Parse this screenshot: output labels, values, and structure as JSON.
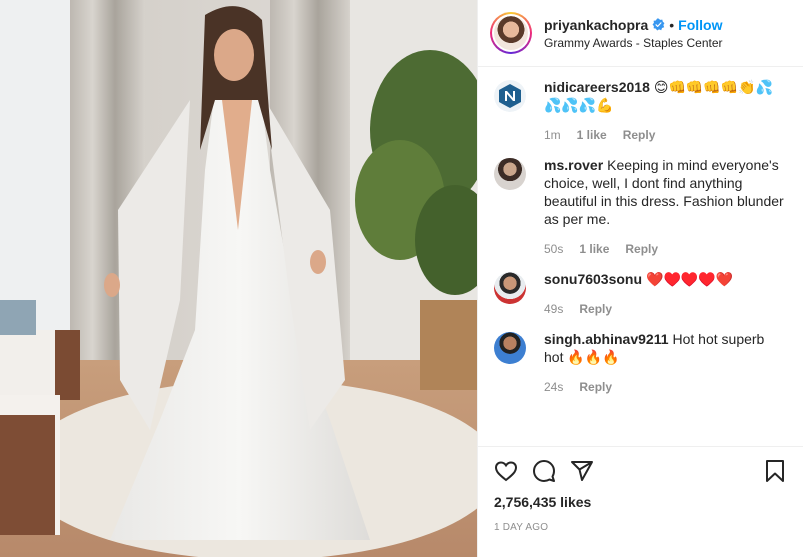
{
  "header": {
    "username": "priyankachopra",
    "separator": "•",
    "follow_label": "Follow",
    "location": "Grammy Awards - Staples Center"
  },
  "comments": [
    {
      "username": "nidicareers2018",
      "text": "😊👊👊👊👊👏💦💦💦💦💪",
      "age": "1m",
      "likes": "1 like",
      "reply": "Reply",
      "avatar": "n-logo-icon"
    },
    {
      "username": "ms.rover",
      "text": "Keeping in mind everyone's choice, well, I dont find anything beautiful in this dress. Fashion blunder as per me.",
      "age": "50s",
      "likes": "1 like",
      "reply": "Reply",
      "avatar": "photo"
    },
    {
      "username": "sonu7603sonu",
      "text": "❤️♥️♥️♥️❤️",
      "age": "49s",
      "reply": "Reply",
      "avatar": "photo"
    },
    {
      "username": "singh.abhinav9211",
      "text": "Hot hot superb hot 🔥🔥🔥",
      "age": "24s",
      "reply": "Reply",
      "avatar": "photo"
    }
  ],
  "actions": {
    "likes_count": "2,756,435 likes",
    "timestamp": "1 DAY AGO"
  },
  "colors": {
    "follow_blue": "#0095f6",
    "text_dark": "#262626",
    "text_muted": "#8e8e8e",
    "heart_red": "#ed4956"
  }
}
